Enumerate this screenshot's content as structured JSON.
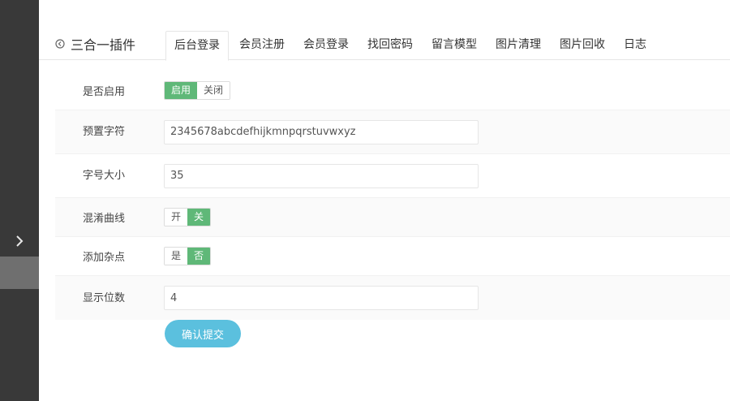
{
  "page_title": "三合一插件",
  "tabs": [
    {
      "label": "后台登录",
      "active": true
    },
    {
      "label": "会员注册",
      "active": false
    },
    {
      "label": "会员登录",
      "active": false
    },
    {
      "label": "找回密码",
      "active": false
    },
    {
      "label": "留言模型",
      "active": false
    },
    {
      "label": "图片清理",
      "active": false
    },
    {
      "label": "图片回收",
      "active": false
    },
    {
      "label": "日志",
      "active": false
    }
  ],
  "form": {
    "enable": {
      "label": "是否启用",
      "on_label": "启用",
      "off_label": "关闭",
      "value": "on"
    },
    "preset_chars": {
      "label": "预置字符",
      "value": "2345678abcdefhijkmnpqrstuvwxyz"
    },
    "font_size": {
      "label": "字号大小",
      "value": "35"
    },
    "curve": {
      "label": "混淆曲线",
      "on_label": "开",
      "off_label": "关",
      "value": "off"
    },
    "noise": {
      "label": "添加杂点",
      "on_label": "是",
      "off_label": "否",
      "value": "off"
    },
    "digits": {
      "label": "显示位数",
      "value": "4"
    },
    "submit_label": "确认提交"
  },
  "colors": {
    "sidebar": "#393939",
    "active_green": "#5fb878",
    "submit_blue": "#5bc0de"
  },
  "icons": {
    "sidebar_expand": "chevron-right-icon",
    "back": "back-circle-icon"
  }
}
